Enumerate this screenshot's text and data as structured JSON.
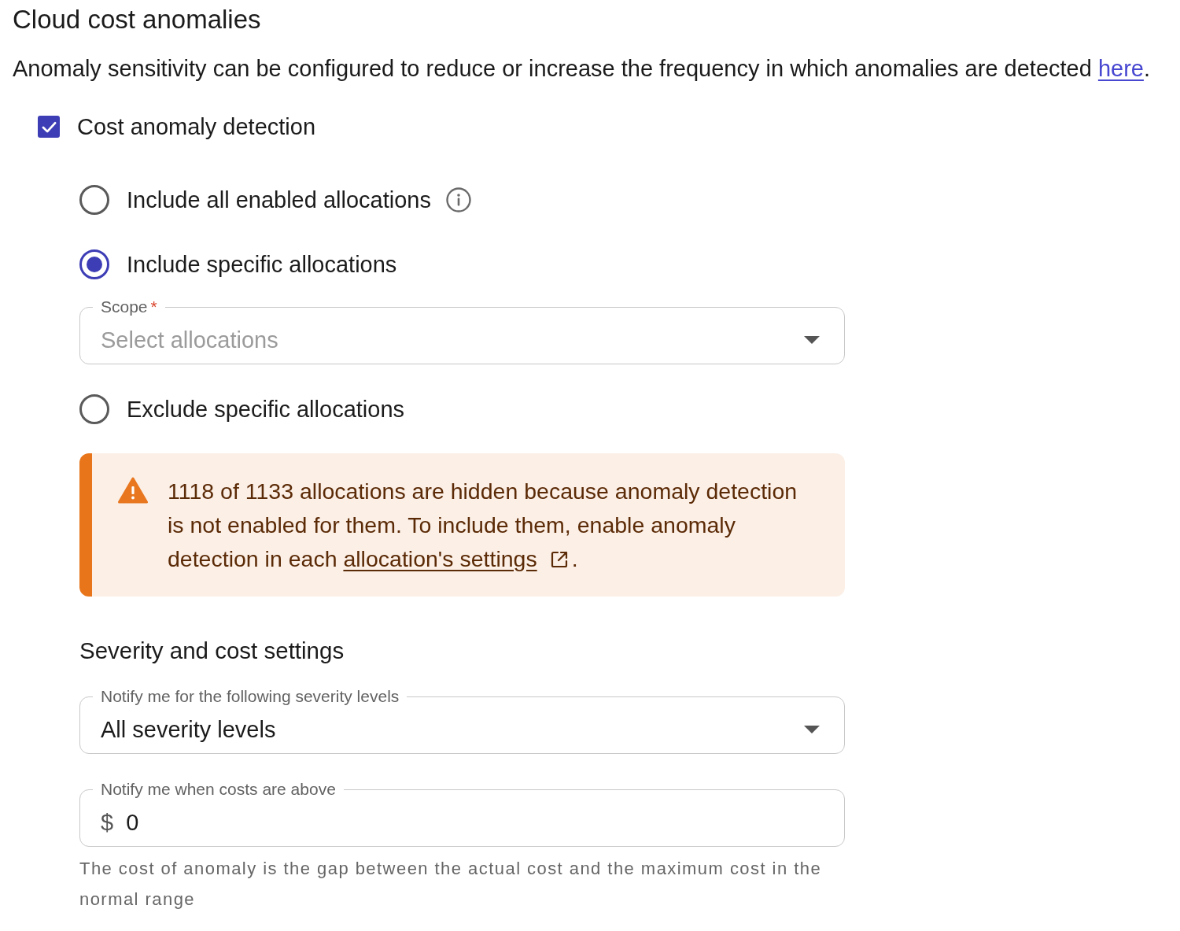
{
  "title": "Cloud cost anomalies",
  "description": {
    "text": "Anomaly sensitivity can be configured to reduce or increase the frequency in which anomalies are detected ",
    "link": "here",
    "end": "."
  },
  "detection": {
    "label": "Cost anomaly detection",
    "checked": true
  },
  "allocation_options": [
    {
      "label": "Include all enabled allocations",
      "selected": false,
      "info": true
    },
    {
      "label": "Include specific allocations",
      "selected": true,
      "info": false,
      "field": {
        "label": "Scope",
        "required_mark": "*",
        "placeholder": "Select allocations"
      }
    },
    {
      "label": "Exclude specific allocations",
      "selected": false,
      "info": false
    }
  ],
  "warning": {
    "text": "1118 of 1133 allocations are hidden because anomaly detection is not enabled for them. To include them, enable anomaly detection in each ",
    "link": "allocation's settings",
    "end": "."
  },
  "severity_section": {
    "heading": "Severity and cost settings",
    "severity_select": {
      "label": "Notify me for the following severity levels",
      "value": "All severity levels"
    },
    "cost_input": {
      "label": "Notify me when costs are above",
      "prefix": "$",
      "value": "0",
      "helper": "The cost of anomaly is the gap between the actual cost and the maximum cost in the normal range"
    }
  }
}
